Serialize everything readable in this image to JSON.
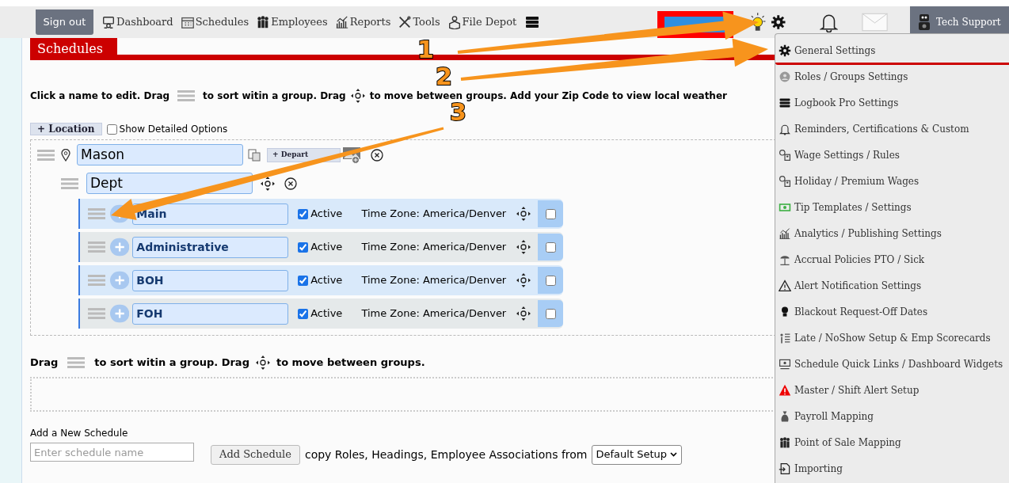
{
  "top_bar": {
    "sign_out": "Sign out",
    "nav": [
      {
        "label": "Dashboard",
        "kind": "dashboard"
      },
      {
        "label": "Schedules",
        "kind": "calendar"
      },
      {
        "label": "Employees",
        "kind": "people"
      },
      {
        "label": "Reports",
        "kind": "chart"
      },
      {
        "label": "Tools",
        "kind": "tools"
      },
      {
        "label": "File Depot",
        "kind": "files"
      }
    ],
    "tech_support": "Tech Support"
  },
  "page_title": "Schedules",
  "instructions": [
    "Click a name to edit. Drag",
    "to sort witin a group. Drag",
    "to move between groups. Add your Zip Code to view local weather"
  ],
  "location_button": "+ Location",
  "show_detailed_options": {
    "label": "Show Detailed Options",
    "checked": false
  },
  "location": {
    "name": "Mason",
    "department_button": "+ Depart",
    "departments": [
      {
        "name": "Dept",
        "schedules": [
          {
            "name": "Main",
            "active": true,
            "active_label": "Active",
            "time_zone": "Time Zone: America/Denver",
            "checked": false
          },
          {
            "name": "Administrative",
            "active": true,
            "active_label": "Active",
            "time_zone": "Time Zone: America/Denver",
            "checked": false
          },
          {
            "name": "BOH",
            "active": true,
            "active_label": "Active",
            "time_zone": "Time Zone: America/Denver",
            "checked": false
          },
          {
            "name": "FOH",
            "active": true,
            "active_label": "Active",
            "time_zone": "Time Zone: America/Denver",
            "checked": false
          }
        ]
      }
    ]
  },
  "group_instructions": [
    "Drag",
    "to sort witin a group. Drag",
    "to move between groups."
  ],
  "add_schedule": {
    "label": "Add a New Schedule",
    "placeholder": "Enter schedule name",
    "button": "Add Schedule",
    "copy_text": "copy Roles, Headings, Employee Associations from",
    "select_value": "Default Setup"
  },
  "settings_menu": [
    {
      "label": "General Settings",
      "kind": "gear",
      "selected": true
    },
    {
      "label": "Roles / Groups Settings",
      "kind": "group",
      "selected": false
    },
    {
      "label": "Logbook Pro Settings",
      "kind": "books",
      "selected": false
    },
    {
      "label": "Reminders, Certifications & Custom",
      "kind": "bell",
      "selected": false
    },
    {
      "label": "Wage Settings / Rules",
      "kind": "wage",
      "selected": false
    },
    {
      "label": "Holiday / Premium Wages",
      "kind": "wage",
      "selected": false
    },
    {
      "label": "Tip Templates / Settings",
      "kind": "money",
      "selected": false
    },
    {
      "label": "Analytics / Publishing Settings",
      "kind": "chart",
      "selected": false
    },
    {
      "label": "Accrual Policies PTO / Sick",
      "kind": "beach",
      "selected": false
    },
    {
      "label": "Alert Notification Settings",
      "kind": "warning",
      "selected": false
    },
    {
      "label": "Blackout Request-Off Dates",
      "kind": "bulb",
      "selected": false
    },
    {
      "label": "Late / NoShow Setup & Emp Scorecards",
      "kind": "list",
      "selected": false
    },
    {
      "label": "Schedule Quick Links / Dashboard Widgets",
      "kind": "widgets",
      "selected": false
    },
    {
      "label": "Master / Shift Alert Setup",
      "kind": "alert",
      "selected": false
    },
    {
      "label": "Payroll Mapping",
      "kind": "bag",
      "selected": false
    },
    {
      "label": "Point of Sale Mapping",
      "kind": "people",
      "selected": false
    },
    {
      "label": "Importing",
      "kind": "import",
      "selected": false
    }
  ],
  "annotations": [
    "1",
    "2",
    "3"
  ]
}
